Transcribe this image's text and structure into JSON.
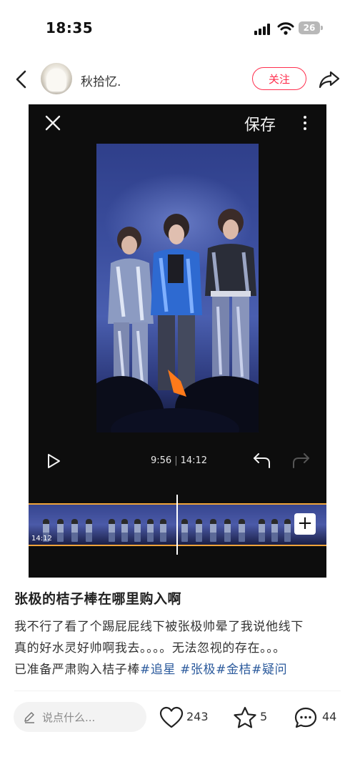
{
  "status": {
    "time": "18:35",
    "battery": "26"
  },
  "header": {
    "username": "秋拾忆.",
    "follow_label": "关注"
  },
  "media": {
    "save_label": "保存",
    "current_time": "9:56",
    "total_time": "14:12",
    "timeline_time": "14:12",
    "add_label": "+"
  },
  "post": {
    "title": "张极的桔子棒在哪里购入啊",
    "line1": "我不行了看了个踢屁屁线下被张极帅晕了我说他线下",
    "line2": "真的好水灵好帅啊我去。。。。无法忽视的存在。。。",
    "line3_text": "已准备严肃购入桔子棒",
    "tags": [
      "#追星",
      "#张极",
      "#金桔",
      "#疑问"
    ]
  },
  "bottom": {
    "comment_placeholder": "说点什么...",
    "likes": "243",
    "collects": "5",
    "comments": "44"
  },
  "colors": {
    "accent": "#ff2e4d",
    "tag": "#2b5a9c",
    "timeline_border": "#f0a43a"
  },
  "icons": [
    "back-icon",
    "share-icon",
    "close-icon",
    "more-icon",
    "play-icon",
    "undo-icon",
    "redo-icon",
    "pen-icon",
    "heart-icon",
    "star-icon",
    "comment-icon"
  ]
}
